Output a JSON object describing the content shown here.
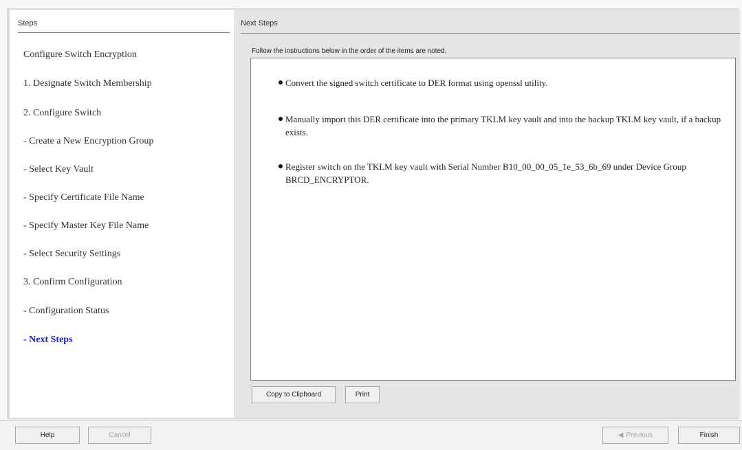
{
  "steps_panel": {
    "header": "Steps",
    "items": [
      {
        "label": "Configure Switch Encryption"
      },
      {
        "label": "1. Designate Switch Membership"
      },
      {
        "label": "2. Configure Switch"
      },
      {
        "label": "- Create a New Encryption Group"
      },
      {
        "label": "- Select Key Vault"
      },
      {
        "label": "- Specify Certificate File Name"
      },
      {
        "label": "- Specify Master Key File Name"
      },
      {
        "label": "- Select Security Settings"
      },
      {
        "label": "3. Confirm Configuration"
      },
      {
        "label": "- Configuration Status"
      },
      {
        "label": "- Next Steps"
      }
    ]
  },
  "content": {
    "header": "Next Steps",
    "instructions": "Follow the instructions below in the order of the items are noted.",
    "bullets": [
      {
        "text": "Convert the signed switch certificate to DER format using openssl utility."
      },
      {
        "text": "Manually import this DER certificate into the primary TKLM key vault and into the backup TKLM key vault, if a backup exists."
      },
      {
        "text": "Register switch on the TKLM key vault with Serial Number B10_00_00_05_1e_53_6b_69 under Device Group BRCD_ENCRYPTOR."
      }
    ],
    "copy_button": "Copy to Clipboard",
    "print_button": "Print"
  },
  "footer": {
    "help_button": "Help",
    "cancel_button": "Cancel",
    "previous_button": "Previous",
    "finish_button": "Finish"
  },
  "colors": {
    "active_step": "#1c1cc8",
    "panel_gray": "#e5e5e5"
  }
}
